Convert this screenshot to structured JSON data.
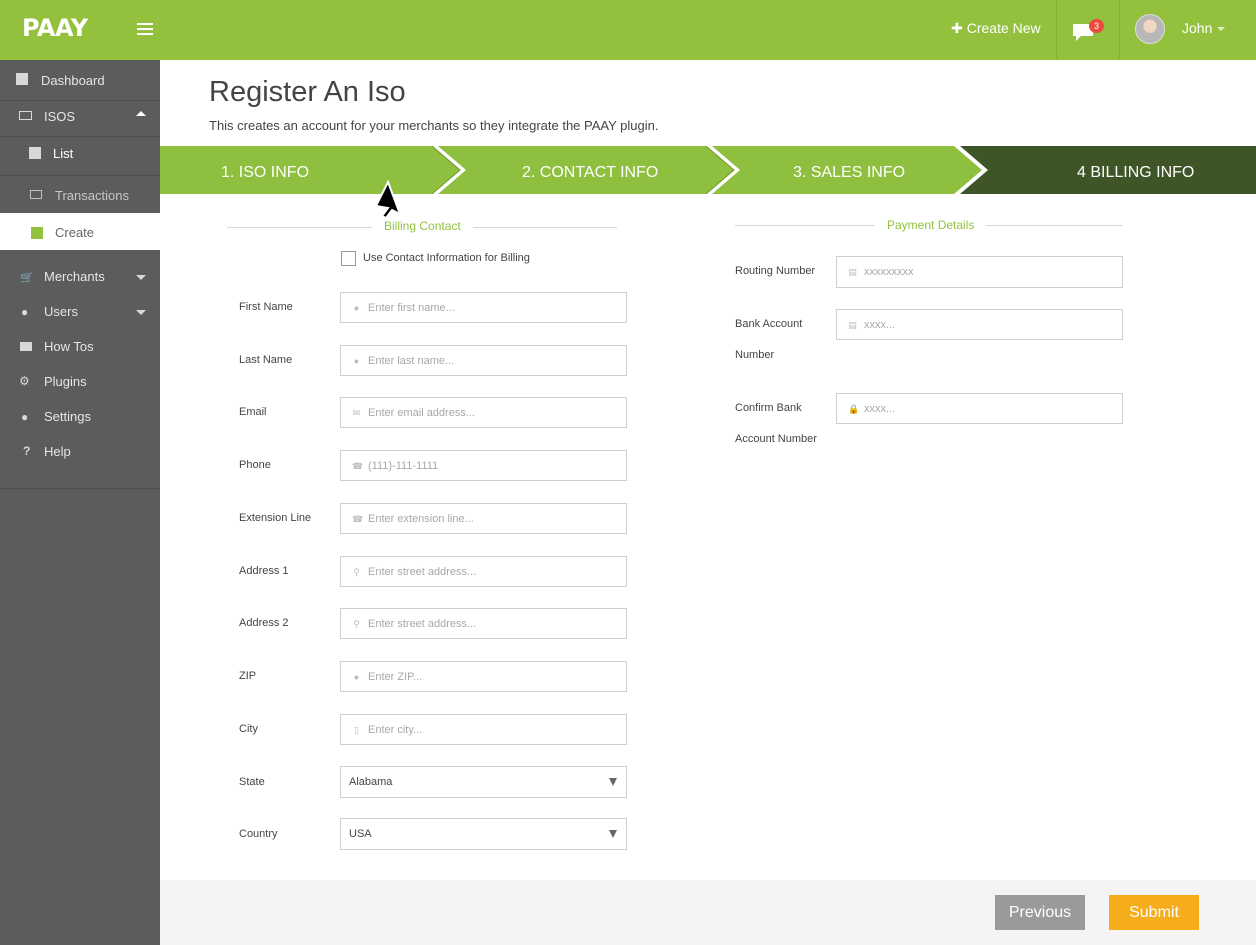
{
  "header": {
    "logo": "PAAY",
    "create_new": "Create New",
    "messages_count": "3",
    "user_name": "John"
  },
  "sidebar": {
    "items": [
      {
        "label": "Dashboard",
        "icon": "square-icon"
      },
      {
        "label": "ISOS",
        "icon": "money-icon"
      },
      {
        "label": "List",
        "icon": "square-icon"
      },
      {
        "label": "Transactions",
        "icon": "monitor-icon"
      },
      {
        "label": "Create",
        "icon": "square-icon"
      },
      {
        "label": "Merchants",
        "icon": "cart-icon"
      },
      {
        "label": "Users",
        "icon": "user-icon"
      },
      {
        "label": "How Tos",
        "icon": "folder-icon"
      },
      {
        "label": "Plugins",
        "icon": "cogs-icon"
      },
      {
        "label": "Settings",
        "icon": "user-icon"
      },
      {
        "label": "Help",
        "icon": "question-icon"
      }
    ]
  },
  "page": {
    "title": "Register An Iso",
    "subtitle": "This creates an account for your merchants so they integrate the PAAY plugin."
  },
  "steps": [
    {
      "label": "1. ISO INFO"
    },
    {
      "label": "2. CONTACT INFO"
    },
    {
      "label": "3. SALES INFO"
    },
    {
      "label": "4 BILLING INFO"
    }
  ],
  "billing": {
    "section_title": "Billing Contact",
    "use_contact_label": "Use Contact Information for Billing",
    "fields": [
      {
        "label": "First Name",
        "placeholder": "Enter first name...",
        "icon": "user-icon"
      },
      {
        "label": "Last Name",
        "placeholder": "Enter last name...",
        "icon": "user-icon"
      },
      {
        "label": "Email",
        "placeholder": "Enter email address...",
        "icon": "envelope-icon"
      },
      {
        "label": "Phone",
        "placeholder": "(111)-111-1111",
        "icon": "phone-icon"
      },
      {
        "label": "Extension Line",
        "placeholder": "Enter extension line...",
        "icon": "phone-icon"
      },
      {
        "label": "Address 1",
        "placeholder": "Enter street address...",
        "icon": "map-marker-icon"
      },
      {
        "label": "Address 2",
        "placeholder": "Enter street address...",
        "icon": "map-marker-icon"
      },
      {
        "label": "ZIP",
        "placeholder": "Enter ZIP...",
        "icon": "circle-icon"
      },
      {
        "label": "City",
        "placeholder": "Enter city...",
        "icon": "building-icon"
      }
    ],
    "state_label": "State",
    "state_value": "Alabama",
    "country_label": "Country",
    "country_value": "USA"
  },
  "payment": {
    "section_title": "Payment Details",
    "routing_label": "Routing Number",
    "routing_placeholder": "xxxxxxxxx",
    "bank_account_label_1": "Bank Account",
    "bank_account_label_2": "Number",
    "bank_account_placeholder": "xxxx...",
    "confirm_label_1": "Confirm Bank",
    "confirm_label_2": "Account Number",
    "confirm_placeholder": "xxxx..."
  },
  "footer": {
    "previous": "Previous",
    "submit": "Submit"
  },
  "colors": {
    "brand_green": "#93c13e",
    "active_step": "#3d5527",
    "sidebar": "#5c5c5c",
    "submit": "#f5ad1c",
    "previous": "#9a9a9a"
  }
}
